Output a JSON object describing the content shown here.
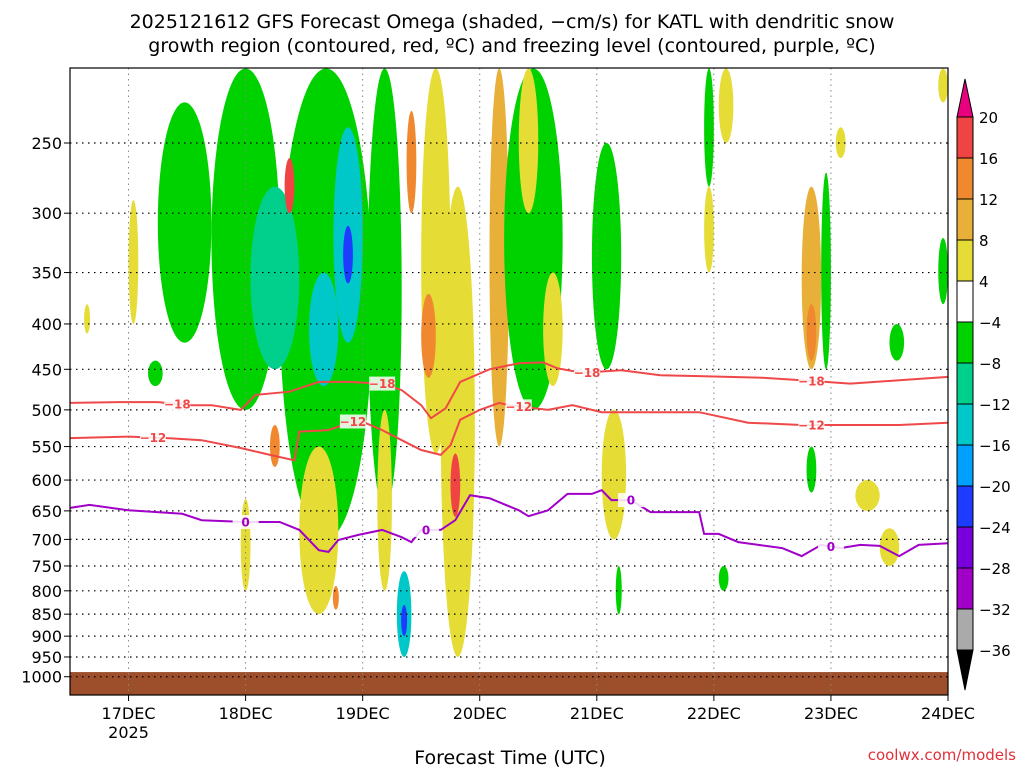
{
  "chart_data": {
    "type": "heatmap",
    "title_lines": [
      "2025121612 GFS Forecast Omega (shaded, −cm/s) for KATL with dendritic snow",
      "growth region (contoured, red, ºC) and freezing level (contoured, purple, ºC)"
    ],
    "xlabel": "Forecast Time (UTC)",
    "xrange_hours": [
      0,
      180
    ],
    "x_ticks": [
      {
        "hour": 12,
        "label": "17DEC",
        "sub": "2025"
      },
      {
        "hour": 36,
        "label": "18DEC"
      },
      {
        "hour": 60,
        "label": "19DEC"
      },
      {
        "hour": 84,
        "label": "20DEC"
      },
      {
        "hour": 108,
        "label": "21DEC"
      },
      {
        "hour": 132,
        "label": "22DEC"
      },
      {
        "hour": 156,
        "label": "23DEC"
      },
      {
        "hour": 180,
        "label": "24DEC"
      }
    ],
    "y_ticks": [
      "250",
      "300",
      "350",
      "400",
      "450",
      "500",
      "550",
      "600",
      "650",
      "700",
      "750",
      "800",
      "850",
      "900",
      "950",
      "1000"
    ],
    "yrange_hPa": [
      206,
      1048
    ],
    "surface_pressure_hPa": 988,
    "grid": true,
    "colorbar": {
      "labels": [
        "20",
        "16",
        "12",
        "8",
        "4",
        "−4",
        "−8",
        "−12",
        "−16",
        "−20",
        "−24",
        "−28",
        "−32",
        "−36"
      ],
      "colors": [
        "#f04444",
        "#f08830",
        "#e8b038",
        "#e6dc36",
        "#ffffff",
        "#00d200",
        "#00d08c",
        "#00c8c8",
        "#00a0ff",
        "#1e3cff",
        "#7800dc",
        "#a000c8",
        "#aaaaaa"
      ],
      "over_color": "#e8007f",
      "under_color": "#000000"
    },
    "omega_regions": [
      {
        "t0": 18,
        "t1": 29,
        "p0": 225,
        "p1": 420,
        "v": -6
      },
      {
        "t0": 29,
        "t1": 43,
        "p0": 206,
        "p1": 500,
        "v": -6
      },
      {
        "t0": 43,
        "t1": 62,
        "p0": 206,
        "p1": 700,
        "v": -6
      },
      {
        "t0": 61,
        "t1": 68,
        "p0": 206,
        "p1": 650,
        "v": -6
      },
      {
        "t0": 37,
        "t1": 47,
        "p0": 280,
        "p1": 450,
        "v": -10
      },
      {
        "t0": 49,
        "t1": 55,
        "p0": 350,
        "p1": 470,
        "v": -14
      },
      {
        "t0": 54,
        "t1": 60,
        "p0": 240,
        "p1": 420,
        "v": -14
      },
      {
        "t0": 56,
        "t1": 58,
        "p0": 310,
        "p1": 360,
        "v": -22
      },
      {
        "t0": 67,
        "t1": 70,
        "p0": 760,
        "p1": 950,
        "v": -14
      },
      {
        "t0": 68,
        "t1": 69,
        "p0": 830,
        "p1": 900,
        "v": -22
      },
      {
        "t0": 72,
        "t1": 78,
        "p0": 206,
        "p1": 560,
        "v": 6
      },
      {
        "t0": 72,
        "t1": 75,
        "p0": 370,
        "p1": 460,
        "v": 13
      },
      {
        "t0": 69,
        "t1": 71,
        "p0": 230,
        "p1": 300,
        "v": 14
      },
      {
        "t0": 76,
        "t1": 83,
        "p0": 280,
        "p1": 950,
        "v": 6
      },
      {
        "t0": 78,
        "t1": 80,
        "p0": 560,
        "p1": 660,
        "v": 17
      },
      {
        "t0": 86,
        "t1": 90,
        "p0": 206,
        "p1": 550,
        "v": 10
      },
      {
        "t0": 89,
        "t1": 101,
        "p0": 206,
        "p1": 500,
        "v": -6
      },
      {
        "t0": 92,
        "t1": 96,
        "p0": 206,
        "p1": 300,
        "v": 6
      },
      {
        "t0": 97,
        "t1": 101,
        "p0": 350,
        "p1": 470,
        "v": 6
      },
      {
        "t0": 107,
        "t1": 113,
        "p0": 250,
        "p1": 450,
        "v": -6
      },
      {
        "t0": 109,
        "t1": 114,
        "p0": 500,
        "p1": 700,
        "v": 6
      },
      {
        "t0": 112,
        "t1": 113,
        "p0": 750,
        "p1": 850,
        "v": -6
      },
      {
        "t0": 130,
        "t1": 132,
        "p0": 206,
        "p1": 280,
        "v": -6
      },
      {
        "t0": 133,
        "t1": 136,
        "p0": 206,
        "p1": 250,
        "v": 6
      },
      {
        "t0": 130,
        "t1": 132,
        "p0": 280,
        "p1": 350,
        "v": 6
      },
      {
        "t0": 133,
        "t1": 135,
        "p0": 750,
        "p1": 800,
        "v": -6
      },
      {
        "t0": 150,
        "t1": 154,
        "p0": 280,
        "p1": 450,
        "v": 10
      },
      {
        "t0": 151,
        "t1": 153,
        "p0": 380,
        "p1": 440,
        "v": 13
      },
      {
        "t0": 154,
        "t1": 156,
        "p0": 270,
        "p1": 450,
        "v": -6
      },
      {
        "t0": 151,
        "t1": 153,
        "p0": 550,
        "p1": 620,
        "v": -6
      },
      {
        "t0": 161,
        "t1": 166,
        "p0": 600,
        "p1": 650,
        "v": 6
      },
      {
        "t0": 166,
        "t1": 170,
        "p0": 680,
        "p1": 750,
        "v": 6
      },
      {
        "t0": 168,
        "t1": 171,
        "p0": 400,
        "p1": 440,
        "v": -6
      },
      {
        "t0": 178,
        "t1": 180,
        "p0": 320,
        "p1": 380,
        "v": -6
      },
      {
        "t0": 178,
        "t1": 180,
        "p0": 206,
        "p1": 225,
        "v": 6
      },
      {
        "t0": 35,
        "t1": 37,
        "p0": 630,
        "p1": 800,
        "v": 6
      },
      {
        "t0": 47,
        "t1": 55,
        "p0": 550,
        "p1": 850,
        "v": 6
      },
      {
        "t0": 54,
        "t1": 55,
        "p0": 790,
        "p1": 840,
        "v": 13
      },
      {
        "t0": 41,
        "t1": 43,
        "p0": 520,
        "p1": 580,
        "v": 13
      },
      {
        "t0": 63,
        "t1": 66,
        "p0": 500,
        "p1": 800,
        "v": 6
      },
      {
        "t0": 12,
        "t1": 14,
        "p0": 290,
        "p1": 400,
        "v": 6
      },
      {
        "t0": 3,
        "t1": 4,
        "p0": 380,
        "p1": 410,
        "v": 6
      },
      {
        "t0": 16,
        "t1": 19,
        "p0": 440,
        "p1": 470,
        "v": -6
      },
      {
        "t0": 157,
        "t1": 159,
        "p0": 240,
        "p1": 260,
        "v": 6
      },
      {
        "t0": 44,
        "t1": 46,
        "p0": 260,
        "p1": 300,
        "v": 17
      }
    ],
    "contours": [
      {
        "name": "-18",
        "color": "#f04848",
        "label": "−18",
        "label_hours": [
          22,
          64,
          106,
          152
        ],
        "points": [
          [
            0,
            491
          ],
          [
            10,
            490
          ],
          [
            18,
            490
          ],
          [
            25,
            494
          ],
          [
            29,
            494
          ],
          [
            35,
            500
          ],
          [
            38,
            481
          ],
          [
            45,
            477
          ],
          [
            51,
            465
          ],
          [
            57,
            465
          ],
          [
            64,
            467
          ],
          [
            68,
            475
          ],
          [
            72,
            494
          ],
          [
            74,
            511
          ],
          [
            77,
            498
          ],
          [
            80,
            465
          ],
          [
            86,
            450
          ],
          [
            92,
            443
          ],
          [
            97,
            442
          ],
          [
            100,
            449
          ],
          [
            105,
            454
          ],
          [
            113,
            451
          ],
          [
            121,
            457
          ],
          [
            129,
            458
          ],
          [
            142,
            460
          ],
          [
            150,
            463
          ],
          [
            160,
            467
          ],
          [
            170,
            463
          ],
          [
            180,
            459
          ]
        ]
      },
      {
        "name": "-12",
        "color": "#f04848",
        "label": "−12",
        "label_hours": [
          17,
          58,
          92,
          152
        ],
        "points": [
          [
            0,
            538
          ],
          [
            12,
            536
          ],
          [
            20,
            538
          ],
          [
            27,
            541
          ],
          [
            35,
            552
          ],
          [
            41,
            562
          ],
          [
            46,
            570
          ],
          [
            47,
            529
          ],
          [
            53,
            527
          ],
          [
            59,
            513
          ],
          [
            64,
            527
          ],
          [
            68,
            541
          ],
          [
            72,
            555
          ],
          [
            76,
            562
          ],
          [
            78,
            548
          ],
          [
            80,
            513
          ],
          [
            84,
            500
          ],
          [
            88,
            491
          ],
          [
            90,
            494
          ],
          [
            98,
            500
          ],
          [
            103,
            494
          ],
          [
            109,
            503
          ],
          [
            129,
            503
          ],
          [
            139,
            517
          ],
          [
            150,
            520
          ],
          [
            160,
            520
          ],
          [
            170,
            520
          ],
          [
            180,
            517
          ]
        ]
      },
      {
        "name": "0",
        "color": "#a000c8",
        "label": "0",
        "label_hours": [
          36,
          73,
          115,
          156
        ],
        "points": [
          [
            0,
            645
          ],
          [
            4,
            640
          ],
          [
            12,
            649
          ],
          [
            23,
            655
          ],
          [
            27,
            666
          ],
          [
            36,
            669
          ],
          [
            43,
            669
          ],
          [
            47,
            683
          ],
          [
            51,
            720
          ],
          [
            53,
            723
          ],
          [
            55,
            701
          ],
          [
            59,
            692
          ],
          [
            64,
            683
          ],
          [
            68,
            696
          ],
          [
            70,
            705
          ],
          [
            72,
            683
          ],
          [
            76,
            683
          ],
          [
            79,
            666
          ],
          [
            82,
            624
          ],
          [
            86,
            629
          ],
          [
            92,
            649
          ],
          [
            94,
            659
          ],
          [
            98,
            649
          ],
          [
            102,
            622
          ],
          [
            107,
            622
          ],
          [
            109,
            616
          ],
          [
            111,
            632
          ],
          [
            115,
            632
          ],
          [
            119,
            652
          ],
          [
            129,
            652
          ],
          [
            130,
            690
          ],
          [
            133,
            690
          ],
          [
            137,
            705
          ],
          [
            146,
            716
          ],
          [
            150,
            731
          ],
          [
            154,
            710
          ],
          [
            158,
            716
          ],
          [
            162,
            710
          ],
          [
            166,
            712
          ],
          [
            170,
            731
          ],
          [
            174,
            710
          ],
          [
            180,
            707
          ]
        ]
      }
    ]
  },
  "credit": "coolwx.com/models"
}
